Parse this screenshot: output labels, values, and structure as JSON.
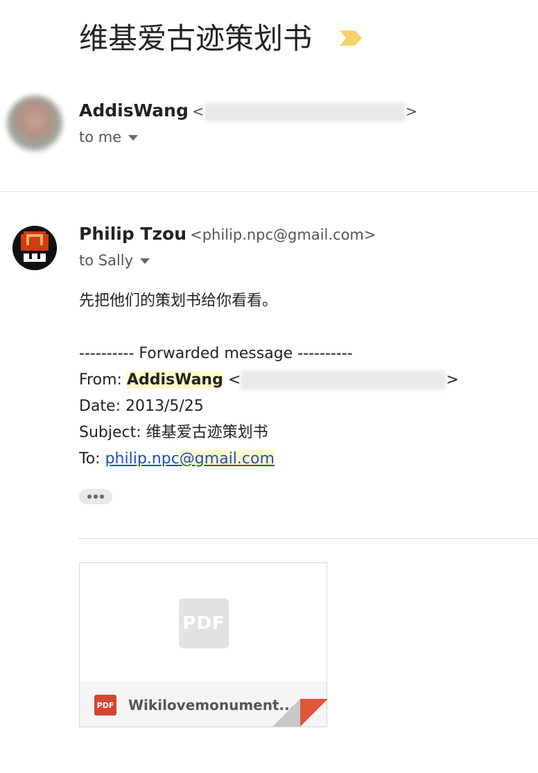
{
  "subject": "维基爱古迹策划书",
  "colors": {
    "importance": "#f5d36b",
    "link": "#1a4fbf",
    "highlight": "#fff9c7",
    "pdf_red": "#d4462f"
  },
  "message1": {
    "sender_name": "AddisWang",
    "to_label": "to me"
  },
  "message2": {
    "sender_name": "Philip Tzou",
    "sender_email": "<philip.npc@gmail.com>",
    "to_label": "to Sally",
    "body_line": "先把他们的策划书给你看看。",
    "forward_header": "---------- Forwarded message ----------",
    "from_label": "From: ",
    "from_name": "AddisWang",
    "date_line": "Date: 2013/5/25",
    "subject_line": "Subject: 维基爱古迹策划书",
    "to_prefix": "To: ",
    "to_link_part1": "philip.npc",
    "to_link_at": "@g",
    "to_link_part2": "mail.com"
  },
  "attachment": {
    "file_name": "Wikilovemonument...",
    "type_label": "PDF"
  }
}
